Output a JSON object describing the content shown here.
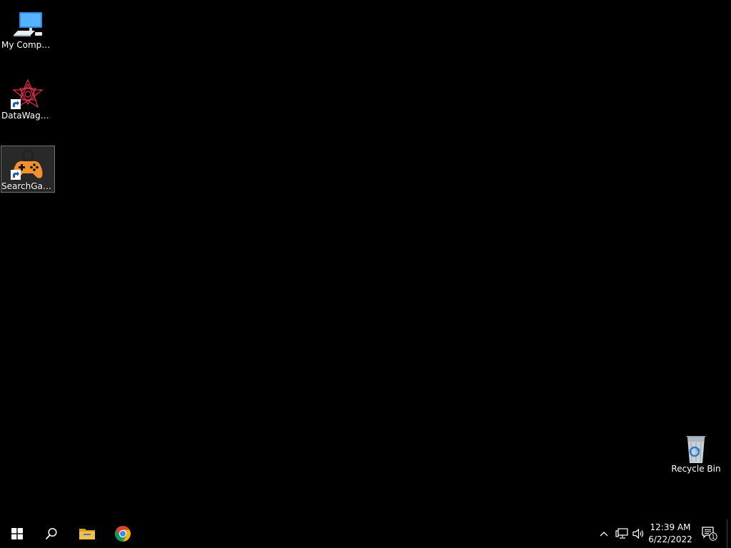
{
  "desktop": {
    "icons": [
      {
        "label": "My Computer",
        "icon": "computer-icon"
      },
      {
        "label": "DataWagon...",
        "icon": "datawagon-icon"
      },
      {
        "label": "SearchGam...",
        "icon": "gamepad-icon",
        "selected": true
      },
      {
        "label": "Recycle Bin",
        "icon": "recycle-bin-icon"
      }
    ]
  },
  "taskbar": {
    "start": "windows-logo-icon",
    "search": "search-icon",
    "pinned": [
      "file-explorer-icon",
      "chrome-icon"
    ],
    "tray": [
      "chevron-up-icon",
      "network-icon",
      "volume-icon"
    ],
    "clock": {
      "time": "12:39 AM",
      "date": "6/22/2022"
    },
    "notifications": {
      "icon": "action-center-icon",
      "count": "1"
    }
  },
  "colors": {
    "background": "#000000",
    "gamepad": "#f5902f",
    "folder": "#f4c04a"
  }
}
